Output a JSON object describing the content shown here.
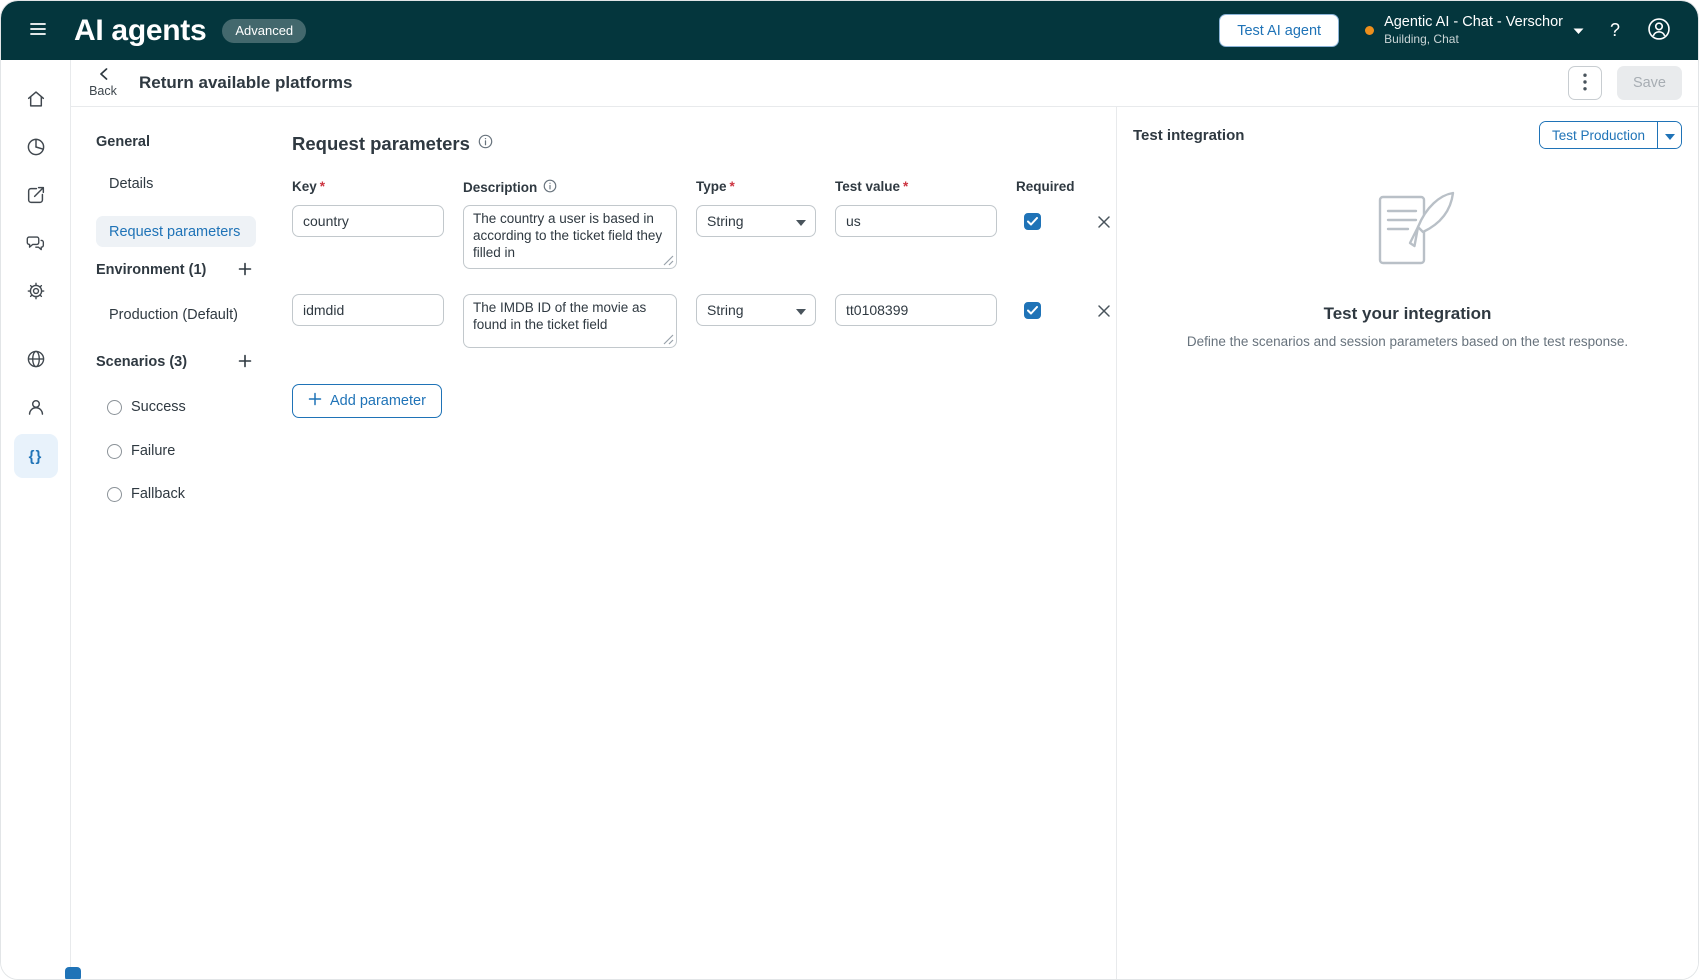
{
  "colors": {
    "header_bg": "#04363d",
    "accent_blue": "#1f73b7",
    "selected_nav_bg": "#eef2f6",
    "rail_selected_bg": "#e8f2fb",
    "checkbox_checked": "#1f73b7",
    "agent_status_dot": "#ee8f1c",
    "required_asterisk": "#cc3340"
  },
  "icons": {
    "braces": "{}",
    "help": "?"
  },
  "header": {
    "title": "AI agents",
    "badge": "Advanced",
    "test_button": "Test AI agent",
    "agent_name": "Agentic AI - Chat - Verschor",
    "agent_meta": "Building, Chat"
  },
  "toolbar": {
    "back": "Back",
    "title": "Return available platforms",
    "save": "Save"
  },
  "sidebar": {
    "general_heading": "General",
    "details": "Details",
    "request_parameters": "Request parameters",
    "environment_heading": "Environment (1)",
    "production": "Production (Default)",
    "scenarios_heading": "Scenarios (3)",
    "scenarios": [
      "Success",
      "Failure",
      "Fallback"
    ]
  },
  "form": {
    "title": "Request parameters",
    "required_marker": "*",
    "columns": {
      "key": "Key",
      "description": "Description",
      "type": "Type",
      "test_value": "Test value",
      "required": "Required"
    },
    "rows": [
      {
        "key": "country",
        "description": "The country a user is based in according to the ticket field they filled in",
        "type": "String",
        "test_value": "us",
        "required": true
      },
      {
        "key": "idmdid",
        "description": "The IMDB ID of the movie as found in the ticket field",
        "type": "String",
        "test_value": "tt0108399",
        "required": true
      }
    ],
    "add_button": "Add parameter"
  },
  "panel": {
    "title": "Test integration",
    "test_button": "Test Production",
    "empty_title": "Test your integration",
    "empty_desc": "Define the scenarios and session parameters based on the test response."
  }
}
